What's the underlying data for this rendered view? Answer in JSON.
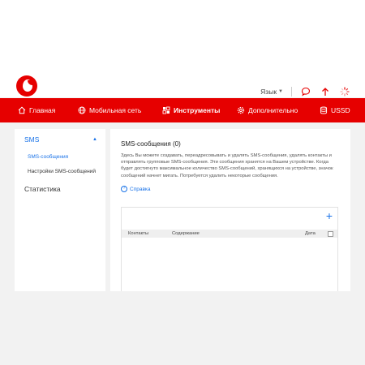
{
  "header": {
    "logo_icon": "vodafone-logo",
    "language_label": "Язык",
    "icons": [
      "messages-icon",
      "upload-icon",
      "loading-icon"
    ]
  },
  "nav": {
    "items": [
      {
        "label": "Главная",
        "icon": "home-icon"
      },
      {
        "label": "Мобильная сеть",
        "icon": "globe-icon"
      },
      {
        "label": "Инструменты",
        "icon": "tools-icon",
        "active": true
      },
      {
        "label": "Дополнительно",
        "icon": "gear-icon"
      },
      {
        "label": "USSD",
        "icon": "database-icon"
      }
    ]
  },
  "sidebar": {
    "group_sms": "SMS",
    "sms_messages": "SMS-сообщения",
    "sms_settings": "Настройки SMS-сообщений",
    "statistics": "Статистика"
  },
  "main": {
    "title": "SMS-сообщения (0)",
    "description": "Здесь Вы можете создавать, переадресовывать и удалять SMS-сообщения, удалять контакты и отправлять групповые SMS-сообщения. Эти сообщения хранятся на Вашем устройстве. Когда будет достигнуто максимальное количество SMS-сообщений, хранящихся на устройстве, значок сообщений начнет мигать. Потребуется удалить некоторые сообщения.",
    "help_label": "Справка",
    "table": {
      "add_label": "+",
      "columns": [
        "Контакты",
        "Содержание",
        "Дата"
      ]
    }
  },
  "colors": {
    "brand_red": "#e60000",
    "link_blue": "#1a73e8"
  }
}
